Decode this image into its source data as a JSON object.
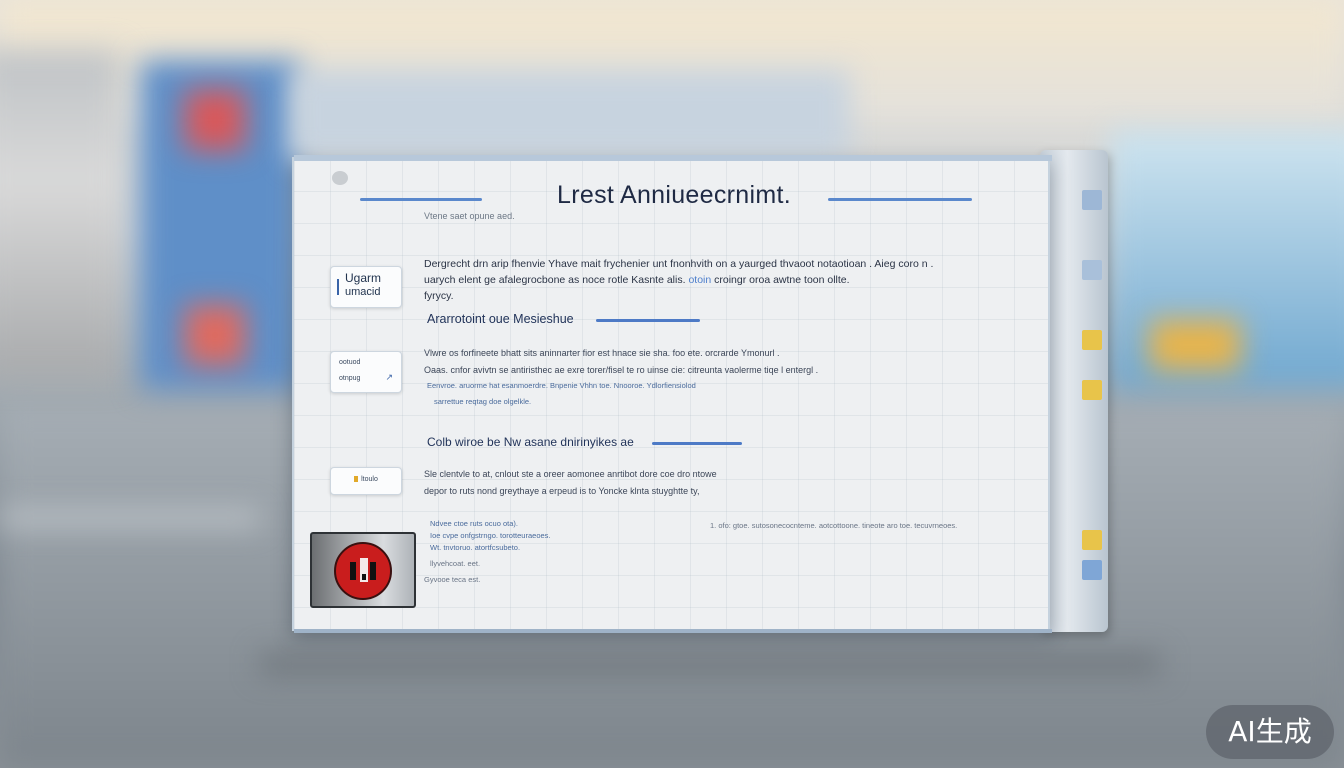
{
  "window": {
    "title": "Lrest Anniueecrnimt.",
    "subtitle": "Vtene saet opune aed.",
    "intro": {
      "line1": "Dergrecht drn arip fhenvie Yhave mait frychenier unt fnonhvith on a yaurged thvaoot notaotioan . Aieg coro n .",
      "line2_before": "uarych elent ge afalegrocbone as noce rotle Kasnte alis.",
      "line2_link": "otoin",
      "line2_after": "croingr oroa awtne toon ollte.",
      "line3": "fyrycy."
    },
    "section1": {
      "heading": "Ararrotoint oue Mesieshue",
      "lines": [
        "Vlwre os forfineete bhatt sits aninnarter fior est hnace sie sha. foo ete. orcrarde Ymonurl .",
        "Oaas. cnfor avivtn se antiristhec ae exre torer/fisel te ro uinse cie: citreunta vaolerme tiqe l entergl ."
      ],
      "bullets": [
        "Eenvroe. aruorme hat esanmoerdre. Bnpenie Vhhn toe. Nnooroe. Ydlorfiensiolod",
        "sarrettue reqtag doe olgelkle."
      ]
    },
    "section2": {
      "heading": "Colb wiroe be Nw asane dnirinyikes ae",
      "lines": [
        "Sle clentvle to at, cnlout ste a oreer aomonee anrtibot dore coe dro ntowe",
        "depor to ruts nond greythaye a erpeud is to Yoncke klnta stuyghtte ty,"
      ],
      "bullets_left": [
        "Ndvee ctoe ruts ocuo ota).",
        "Ioe cvpe onfgstrngo. torotteuraeoes.",
        "Wt. tnvtoruo. atortfcsubeto.",
        "llyvehcoat. eet.",
        "Gyvooe teca est."
      ],
      "bullets_right": [
        "1. ofo: gtoe. sutosonecocnteme. aotcottoone. tineote aro toe. tecuvrneoes."
      ]
    },
    "side_buttons": {
      "btn1_line1": "Ugarm",
      "btn1_line2": "umacid",
      "btn2_line1": "ootuod",
      "btn2_line2": "otnpug",
      "btn2_arrow": "↗",
      "btn3_label": "ltoulo"
    }
  },
  "watermark": "AI生成",
  "colors": {
    "accent": "#4d7ac6",
    "title_text": "#1f2a44",
    "logo_red": "#c91d1d"
  },
  "icons": [
    "camera-icon",
    "arrow-up-right-icon",
    "logo-emblem-icon"
  ]
}
